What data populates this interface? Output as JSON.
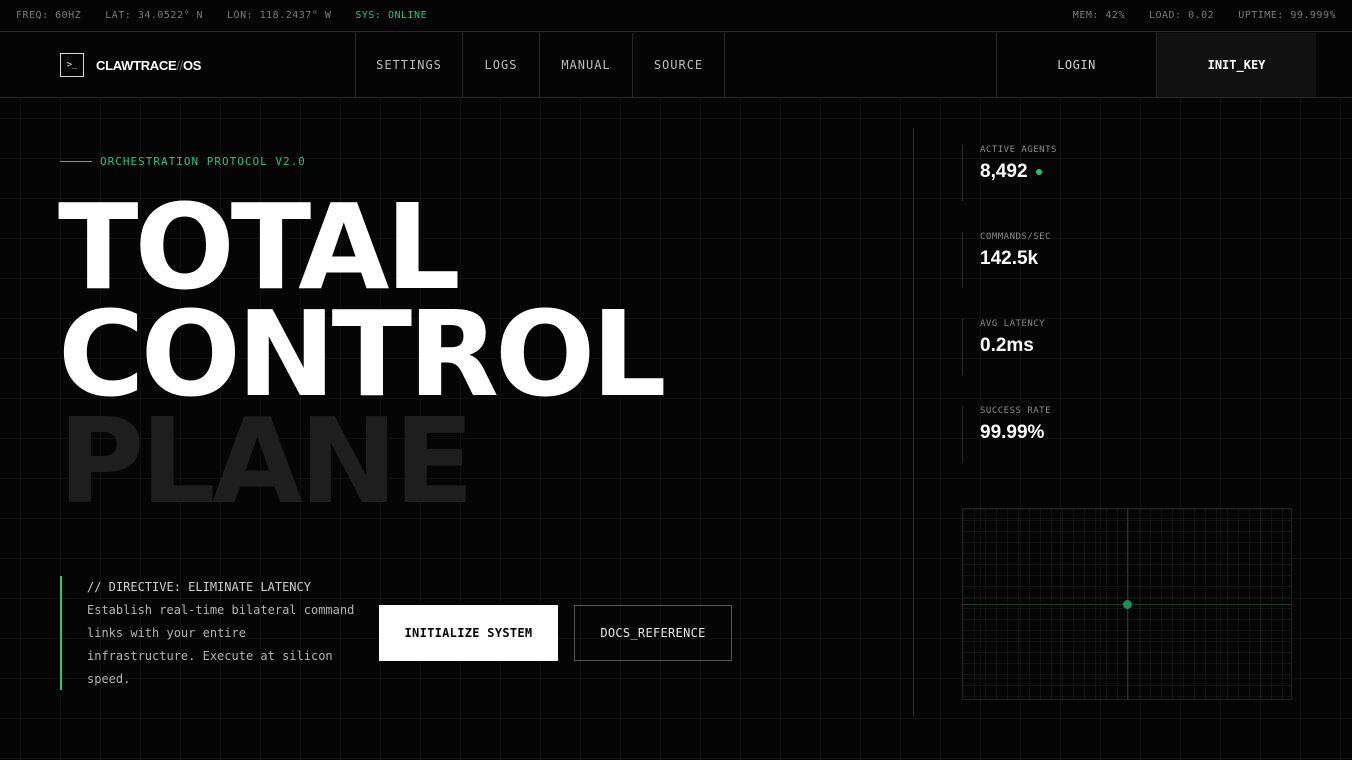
{
  "status": {
    "freq": "FREQ: 60HZ",
    "lat": "LAT: 34.0522° N",
    "lon": "LON: 118.2437° W",
    "sys": "SYS: ONLINE",
    "mem": "MEM: 42%",
    "load": "LOAD: 0.02",
    "uptime": "UPTIME: 99.999%"
  },
  "brand": {
    "icon": ">_",
    "name": "CLAWTRACE",
    "sep": "//",
    "suffix": "OS"
  },
  "nav": {
    "items": [
      {
        "label": "SETTINGS"
      },
      {
        "label": "LOGS"
      },
      {
        "label": "MANUAL"
      },
      {
        "label": "SOURCE"
      }
    ],
    "login": "LOGIN",
    "init_key": "INIT_KEY"
  },
  "hero": {
    "protocol": "ORCHESTRATION PROTOCOL V2.0",
    "line1": "TOTAL",
    "line2": "CONTROL",
    "line3": "PLANE",
    "directive_title": "// DIRECTIVE: ELIMINATE LATENCY",
    "directive_body": "Establish real-time bilateral command links with your entire infrastructure. Execute at silicon speed.",
    "primary_cta": "INITIALIZE SYSTEM",
    "secondary_cta": "DOCS_REFERENCE"
  },
  "metrics": [
    {
      "label": "ACTIVE AGENTS",
      "value": "8,492"
    },
    {
      "label": "COMMANDS/SEC",
      "value": "142.5k"
    },
    {
      "label": "AVG LATENCY",
      "value": "0.2ms"
    },
    {
      "label": "SUCCESS RATE",
      "value": "99.99%"
    }
  ],
  "colors": {
    "accent": "#22c57a",
    "background": "#050505"
  }
}
